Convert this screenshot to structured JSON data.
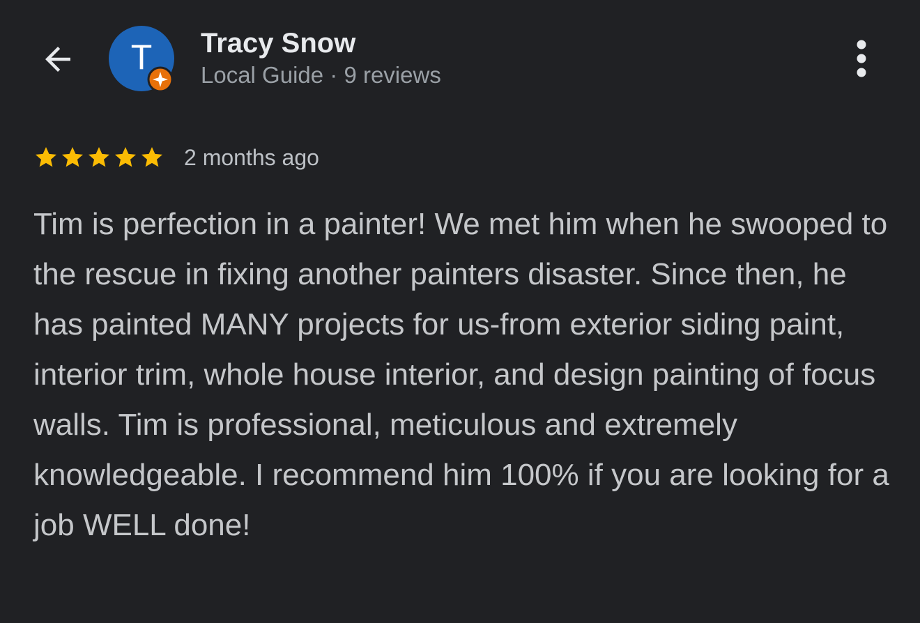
{
  "header": {
    "avatar_initial": "T",
    "name": "Tracy Snow",
    "meta": "Local Guide · 9 reviews"
  },
  "review": {
    "stars": 5,
    "max_stars": 5,
    "time_ago": "2 months ago",
    "text": "Tim is perfection in a painter! We met him when he swooped to the rescue in fixing another painters disaster. Since then, he has painted MANY projects for us-from exterior siding paint, interior trim, whole house interior, and design painting of focus walls. Tim is professional, meticulous and extremely knowledgeable. I recommend him 100% if you are looking for a job WELL done!"
  },
  "icons": {
    "back": "arrow-back-icon",
    "more": "more-vert-icon",
    "badge": "local-guide-badge-icon",
    "star": "star-icon"
  },
  "colors": {
    "background": "#202124",
    "avatar": "#1d64b7",
    "badge": "#e8710a",
    "star": "#fbbc04",
    "name": "#e8eaed",
    "secondary": "#9aa0a6",
    "body": "#c5c7ca"
  }
}
